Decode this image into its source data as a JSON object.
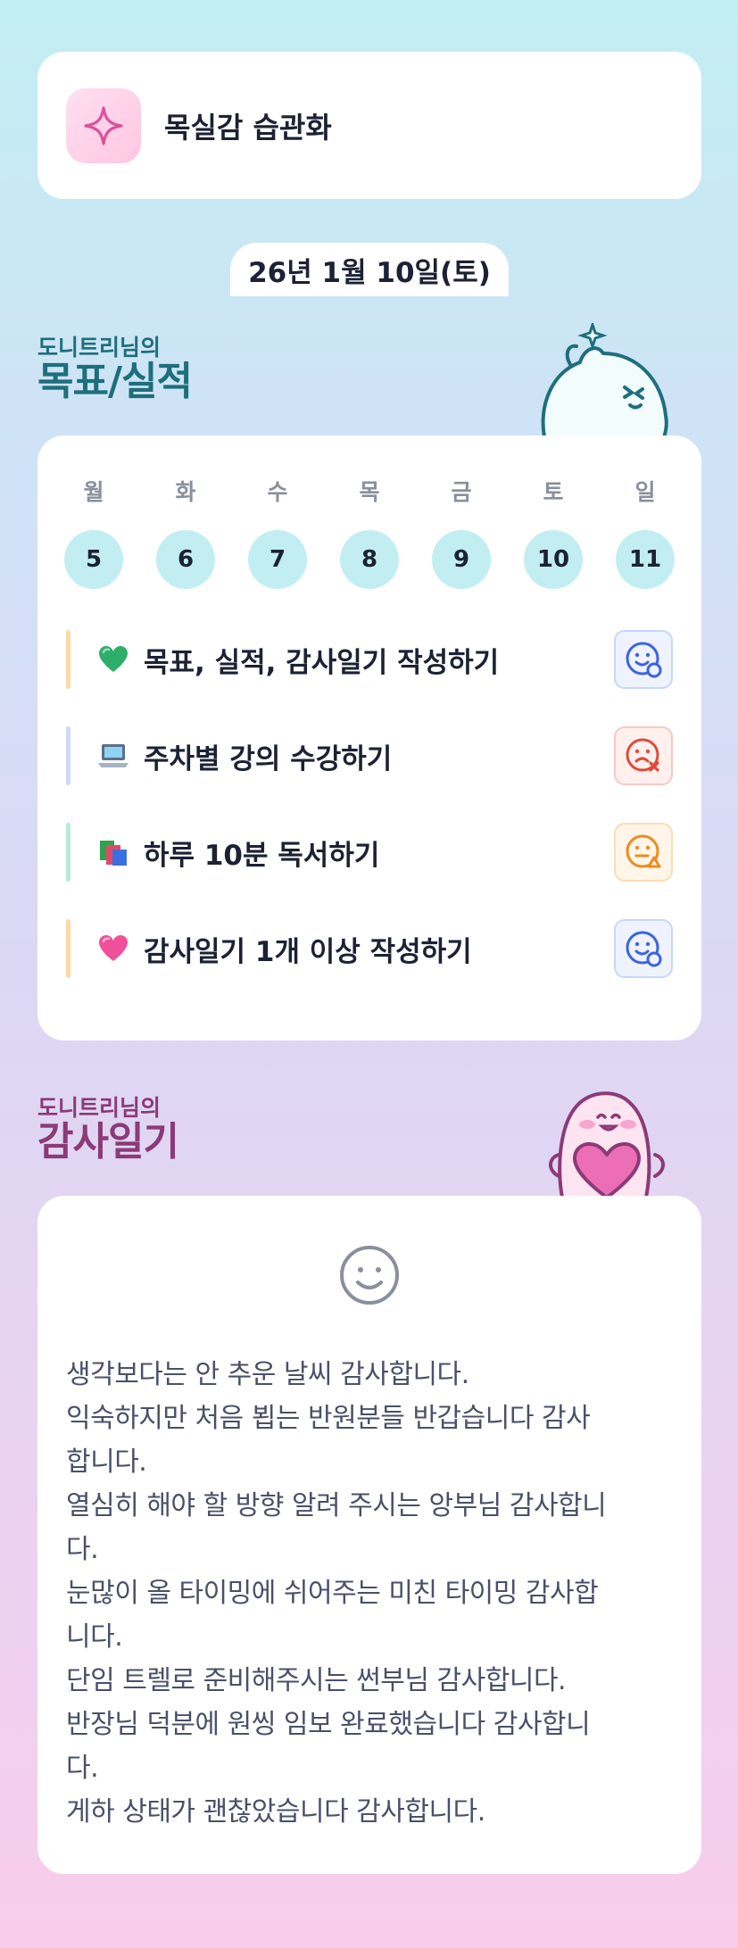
{
  "habit": {
    "title": "목실감 습관화",
    "icon": "sparkle-icon",
    "accent": "#e04f9a"
  },
  "date": "26년 1월 10일(토)",
  "goals_section": {
    "subtitle": "도니트리님의",
    "title": "목표/실적"
  },
  "week": [
    {
      "label": "월",
      "num": "5"
    },
    {
      "label": "화",
      "num": "6"
    },
    {
      "label": "수",
      "num": "7"
    },
    {
      "label": "목",
      "num": "8"
    },
    {
      "label": "금",
      "num": "9"
    },
    {
      "label": "토",
      "num": "10"
    },
    {
      "label": "일",
      "num": "11"
    }
  ],
  "goals": [
    {
      "emoji": "green-heart",
      "text": "목표, 실적, 감사일기 작성하기",
      "bar_color": "#fcd9a8",
      "status": "done"
    },
    {
      "emoji": "laptop",
      "text": "주차별 강의 수강하기",
      "bar_color": "#cdd9fb",
      "status": "failed"
    },
    {
      "emoji": "books",
      "text": "하루 10분 독서하기",
      "bar_color": "#b5ecd6",
      "status": "partial"
    },
    {
      "emoji": "pink-heart",
      "text": "감사일기 1개 이상 작성하기",
      "bar_color": "#fcd9a8",
      "status": "done"
    }
  ],
  "diary_section": {
    "subtitle": "도니트리님의",
    "title": "감사일기"
  },
  "diary": {
    "mood_icon": "smile-face-icon",
    "lines": [
      "생각보다는 안 추운 날씨 감사합니다.",
      "익숙하지만 처음 뵙는 반원분들 반갑습니다 감사",
      "합니다.",
      "열심히 해야 할 방향 알려 주시는 앙부님 감사합니",
      "다.",
      "눈많이 올 타이밍에 쉬어주는 미친 타이밍 감사합",
      "니다.",
      "단임 트렐로 준비해주시는 썬부님 감사합니다.",
      "반장님 덕분에 원씽 임보 완료했습니다 감사합니",
      "다.",
      "게하 상태가 괜찮았습니다 감사합니다."
    ]
  },
  "colors": {
    "teal": "#1e6f7c",
    "plum": "#8c3a78",
    "day_bg": "#c2eef2"
  }
}
